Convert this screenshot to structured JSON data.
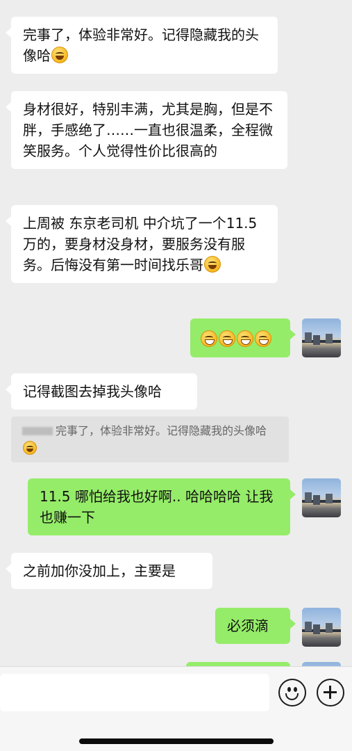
{
  "messages": [
    {
      "side": "in",
      "text": "完事了，体验非常好。记得隐藏我的头像哈",
      "emoji": "laugh-tears"
    },
    {
      "side": "in",
      "text": "身材很好，特别丰满，尤其是胸，但是不胖，手感绝了……一直也很温柔，全程微笑服务。个人觉得性价比很高的"
    },
    {
      "side": "in",
      "text": "上周被 东京老司机 中介坑了一个11.5万的，要身材没身材，要服务没有服务。后悔没有第一时间找乐哥",
      "emoji": "laugh-tears"
    },
    {
      "side": "out",
      "emoji": "grin x4"
    },
    {
      "side": "in",
      "text": "记得截图去掉我头像哈"
    },
    {
      "side": "out",
      "text": "11.5 哪怕给我也好啊.. 哈哈哈哈 让我也赚一下"
    },
    {
      "side": "in",
      "text": "之前加你没加上，主要是"
    },
    {
      "side": "out",
      "text": "必须滴"
    }
  ],
  "quote": {
    "text": "完事了，体验非常好。记得隐藏我的头像哈"
  },
  "input_bar": {
    "emoji_icon": "smiley-icon",
    "plus_icon": "plus-circle-icon"
  },
  "colors": {
    "background": "#ededed",
    "incoming": "#ffffff",
    "outgoing": "#95ec69"
  }
}
